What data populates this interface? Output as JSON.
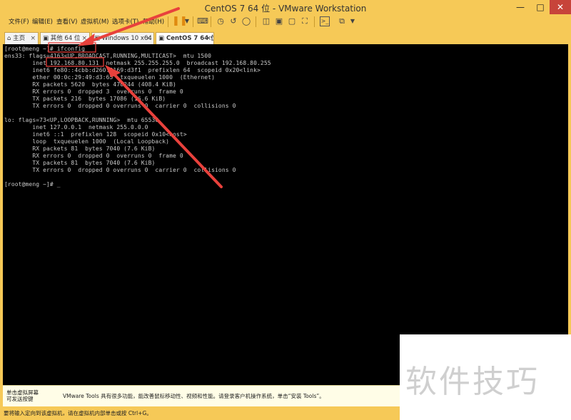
{
  "window": {
    "title": "CentOS 7 64 位 - VMware Workstation"
  },
  "menu": [
    "文件(F)",
    "编辑(E)",
    "查看(V)",
    "虚拟机(M)",
    "选项卡(T)",
    "帮助(H)"
  ],
  "tabs": [
    {
      "label": "主页"
    },
    {
      "label": "其他 64 位"
    },
    {
      "label": "Windows 10 x64"
    },
    {
      "label": "CentOS 7 64 位"
    }
  ],
  "console": {
    "lines": [
      "[root@meng ~]# ifconfig",
      "ens33: flags=4163<UP,BROADCAST,RUNNING,MULTICAST>  mtu 1500",
      "        inet 192.168.80.131  netmask 255.255.255.0  broadcast 192.168.80.255",
      "        inet6 fe80::4cbb:d260:9169:d3f1  prefixlen 64  scopeid 0x20<link>",
      "        ether 00:0c:29:49:d3:65  txqueuelen 1000  (Ethernet)",
      "        RX packets 5620  bytes 470244 (408.4 KiB)",
      "        RX errors 0  dropped 3  overruns 0  frame 0",
      "        TX packets 216  bytes 17086 (16.6 KiB)",
      "        TX errors 0  dropped 0 overruns 0  carrier 0  collisions 0",
      "",
      "lo: flags=73<UP,LOOPBACK,RUNNING>  mtu 65536",
      "        inet 127.0.0.1  netmask 255.0.0.0",
      "        inet6 ::1  prefixlen 128  scopeid 0x10<host>",
      "        loop  txqueuelen 1000  (Local Loopback)",
      "        RX packets 81  bytes 7040 (7.6 KiB)",
      "        RX errors 0  dropped 0  overruns 0  frame 0",
      "        TX packets 81  bytes 7040 (7.6 KiB)",
      "        TX errors 0  dropped 0 overruns 0  carrier 0  collisions 0",
      "",
      "[root@meng ~]# _"
    ]
  },
  "tools_bar": {
    "hint_line1": "单击虚拟屏幕",
    "hint_line2": "可发送按键",
    "message": "VMware Tools 具有很多功能，能改善鼠标移动性、视频和性能。请登录客户机操作系统，单击“安装 Tools”。"
  },
  "status_bar": {
    "text": "要将输入定向到该虚拟机，请在虚拟机内部单击或按 Ctrl+G。"
  },
  "watermark": {
    "text": "软件技巧"
  },
  "colors": {
    "frame": "#f6c957",
    "console_bg": "#000000",
    "console_text": "#c8c8c8",
    "annotation": "#e8413c"
  }
}
